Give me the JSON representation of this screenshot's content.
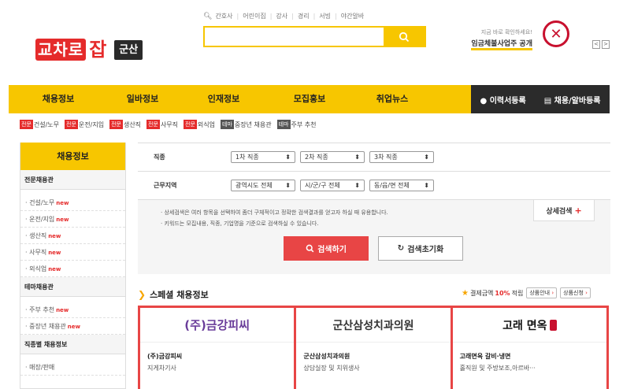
{
  "header": {
    "logo_main": "교차로",
    "logo_sub": "잡",
    "region": "군산",
    "quick_links": [
      "간호사",
      "어린이집",
      "강사",
      "경리",
      "서빙",
      "야간알바"
    ],
    "search_placeholder": "",
    "promo_small": "지금 바로 확인하세요!",
    "promo_bold": "임금체불사업주 공개",
    "pager_prev": "<",
    "pager_next": ">"
  },
  "gnb": {
    "items": [
      "채용정보",
      "일바정보",
      "인재정보",
      "모집홍보",
      "취업뉴스"
    ],
    "resume": "이력서등록",
    "post": "채용/알바등록"
  },
  "tags": [
    {
      "badge": "전문",
      "label": "건설/노무",
      "dark": false
    },
    {
      "badge": "전문",
      "label": "운전/지입",
      "dark": false
    },
    {
      "badge": "전문",
      "label": "생산직",
      "dark": false
    },
    {
      "badge": "전문",
      "label": "사무직",
      "dark": false
    },
    {
      "badge": "전문",
      "label": "외식업",
      "dark": false
    },
    {
      "badge": "테마",
      "label": "중장년 채용관",
      "dark": true
    },
    {
      "badge": "테마",
      "label": "주부 추천",
      "dark": true
    }
  ],
  "sidebar": {
    "title": "채용정보",
    "sections": [
      {
        "title": "전문채용관",
        "items": [
          {
            "label": "건설/노무",
            "new": "new"
          },
          {
            "label": "운전/지입",
            "new": "new"
          },
          {
            "label": "생산직",
            "new": "new"
          },
          {
            "label": "사무직",
            "new": "new"
          },
          {
            "label": "외식업",
            "new": "new"
          }
        ]
      },
      {
        "title": "테마채용관",
        "items": [
          {
            "label": "주부 추천",
            "new": "new"
          },
          {
            "label": "중장년 채용관",
            "new": "new"
          }
        ]
      },
      {
        "title": "직종별 채용정보",
        "items": [
          {
            "label": "매장/판매",
            "new": ""
          }
        ]
      }
    ]
  },
  "filters": {
    "job_label": "직종",
    "job_selects": [
      "1차 직종",
      "2차 직종",
      "3차 직종"
    ],
    "region_label": "근무지역",
    "region_selects": [
      "광역시도 전체",
      "시/군/구 전체",
      "동/읍/면 전체"
    ]
  },
  "info": {
    "line1": "상세검색은 여러 항목을 선택하여 좀더 구체적이고 정확한 검색결과를 얻고자 하실 때 유용합니다.",
    "line2": "키워드는 모집내용, 직종, 기업명을 기준으로 검색하실 수 있습니다.",
    "advanced": "상세검색",
    "search_btn": "검색하기",
    "reset_btn": "검색초기화"
  },
  "special": {
    "title": "스페셜 채용정보",
    "discount_prefix": "결제금액",
    "discount_pct": "10%",
    "discount_suffix": "적립",
    "btn_info": "상품안내",
    "btn_apply": "상품신청",
    "cards": [
      {
        "banner": "(주)금강피씨",
        "name": "(주)금강피씨",
        "desc": "지게차기사"
      },
      {
        "banner": "군산삼성치과의원",
        "name": "군산삼성치과의원",
        "desc": "상담실장 및 치위생사"
      },
      {
        "banner": "고래 면옥",
        "name": "고래면옥 갈비·냉면",
        "desc": "홀직원 및 주방보조,아르바···"
      }
    ]
  }
}
